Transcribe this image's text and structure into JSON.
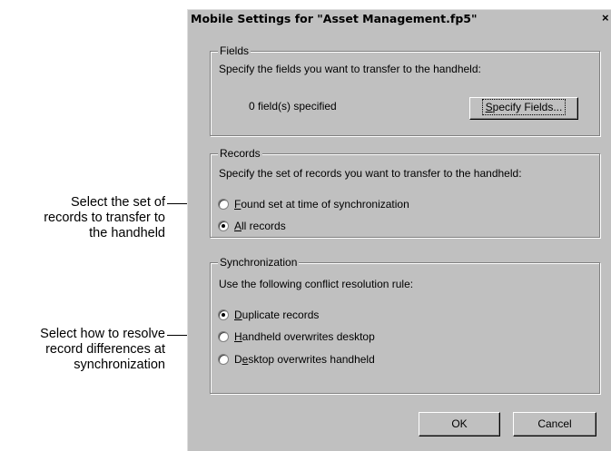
{
  "callouts": {
    "records": {
      "line1": "Select the set of",
      "line2": "records to transfer to",
      "line3": "the handheld"
    },
    "sync": {
      "line1": "Select how to resolve",
      "line2": "record differences at",
      "line3": "synchronization"
    }
  },
  "dialog": {
    "title": "Mobile Settings for \"Asset Management.fp5\"",
    "close_icon": "×"
  },
  "fields": {
    "legend": "Fields",
    "description": "Specify the fields you want to transfer to the handheld:",
    "count_text": "0 field(s) specified",
    "button_prefix": "S",
    "button_rest": "pecify Fields..."
  },
  "records": {
    "legend": "Records",
    "description": "Specify the set of records you want to transfer to the handheld:",
    "options": [
      {
        "mnemonic": "F",
        "rest": "ound set at time of synchronization",
        "selected": false
      },
      {
        "mnemonic": "A",
        "rest": "ll records",
        "selected": true
      }
    ]
  },
  "sync": {
    "legend": "Synchronization",
    "description": "Use the following conflict resolution rule:",
    "options": [
      {
        "pre": "",
        "mnemonic": "D",
        "rest": "uplicate records",
        "selected": true
      },
      {
        "pre": "",
        "mnemonic": "H",
        "rest": "andheld overwrites desktop",
        "selected": false
      },
      {
        "pre": "D",
        "mnemonic": "e",
        "rest": "sktop overwrites handheld",
        "selected": false
      }
    ]
  },
  "buttons": {
    "ok": "OK",
    "cancel": "Cancel"
  }
}
